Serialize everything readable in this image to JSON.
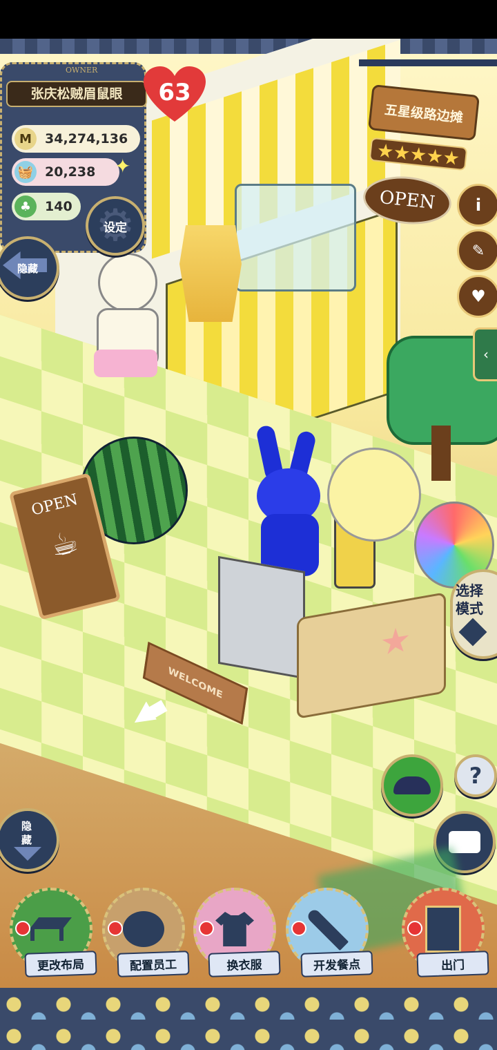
{
  "player": {
    "owner_tag": "OWNER",
    "name": "张庆松贼眉鼠眼",
    "level": "63",
    "money": "34,274,136",
    "ingredients": "20,238",
    "clover": "140"
  },
  "buttons": {
    "settings": "设定",
    "hide_top": "隐藏",
    "hide_bottom": "隐藏",
    "select_mode": "选择模式",
    "help": "?",
    "change_layout": "更改布局",
    "assign_staff": "配置员工",
    "change_clothes": "换衣服",
    "develop_food": "开发餐点",
    "exit": "出门"
  },
  "shop_sign": {
    "title": "五星级路边摊",
    "open": "OPEN",
    "stars": 5
  },
  "scene_text": {
    "board_open": "OPEN",
    "doormat": "WELCOME"
  },
  "colors": {
    "denim": "#3a4a6a",
    "stitch": "#c8b070",
    "wood": "#b5773a",
    "awning_yellow": "#f3dc3c",
    "grass": "#cfe38a"
  }
}
